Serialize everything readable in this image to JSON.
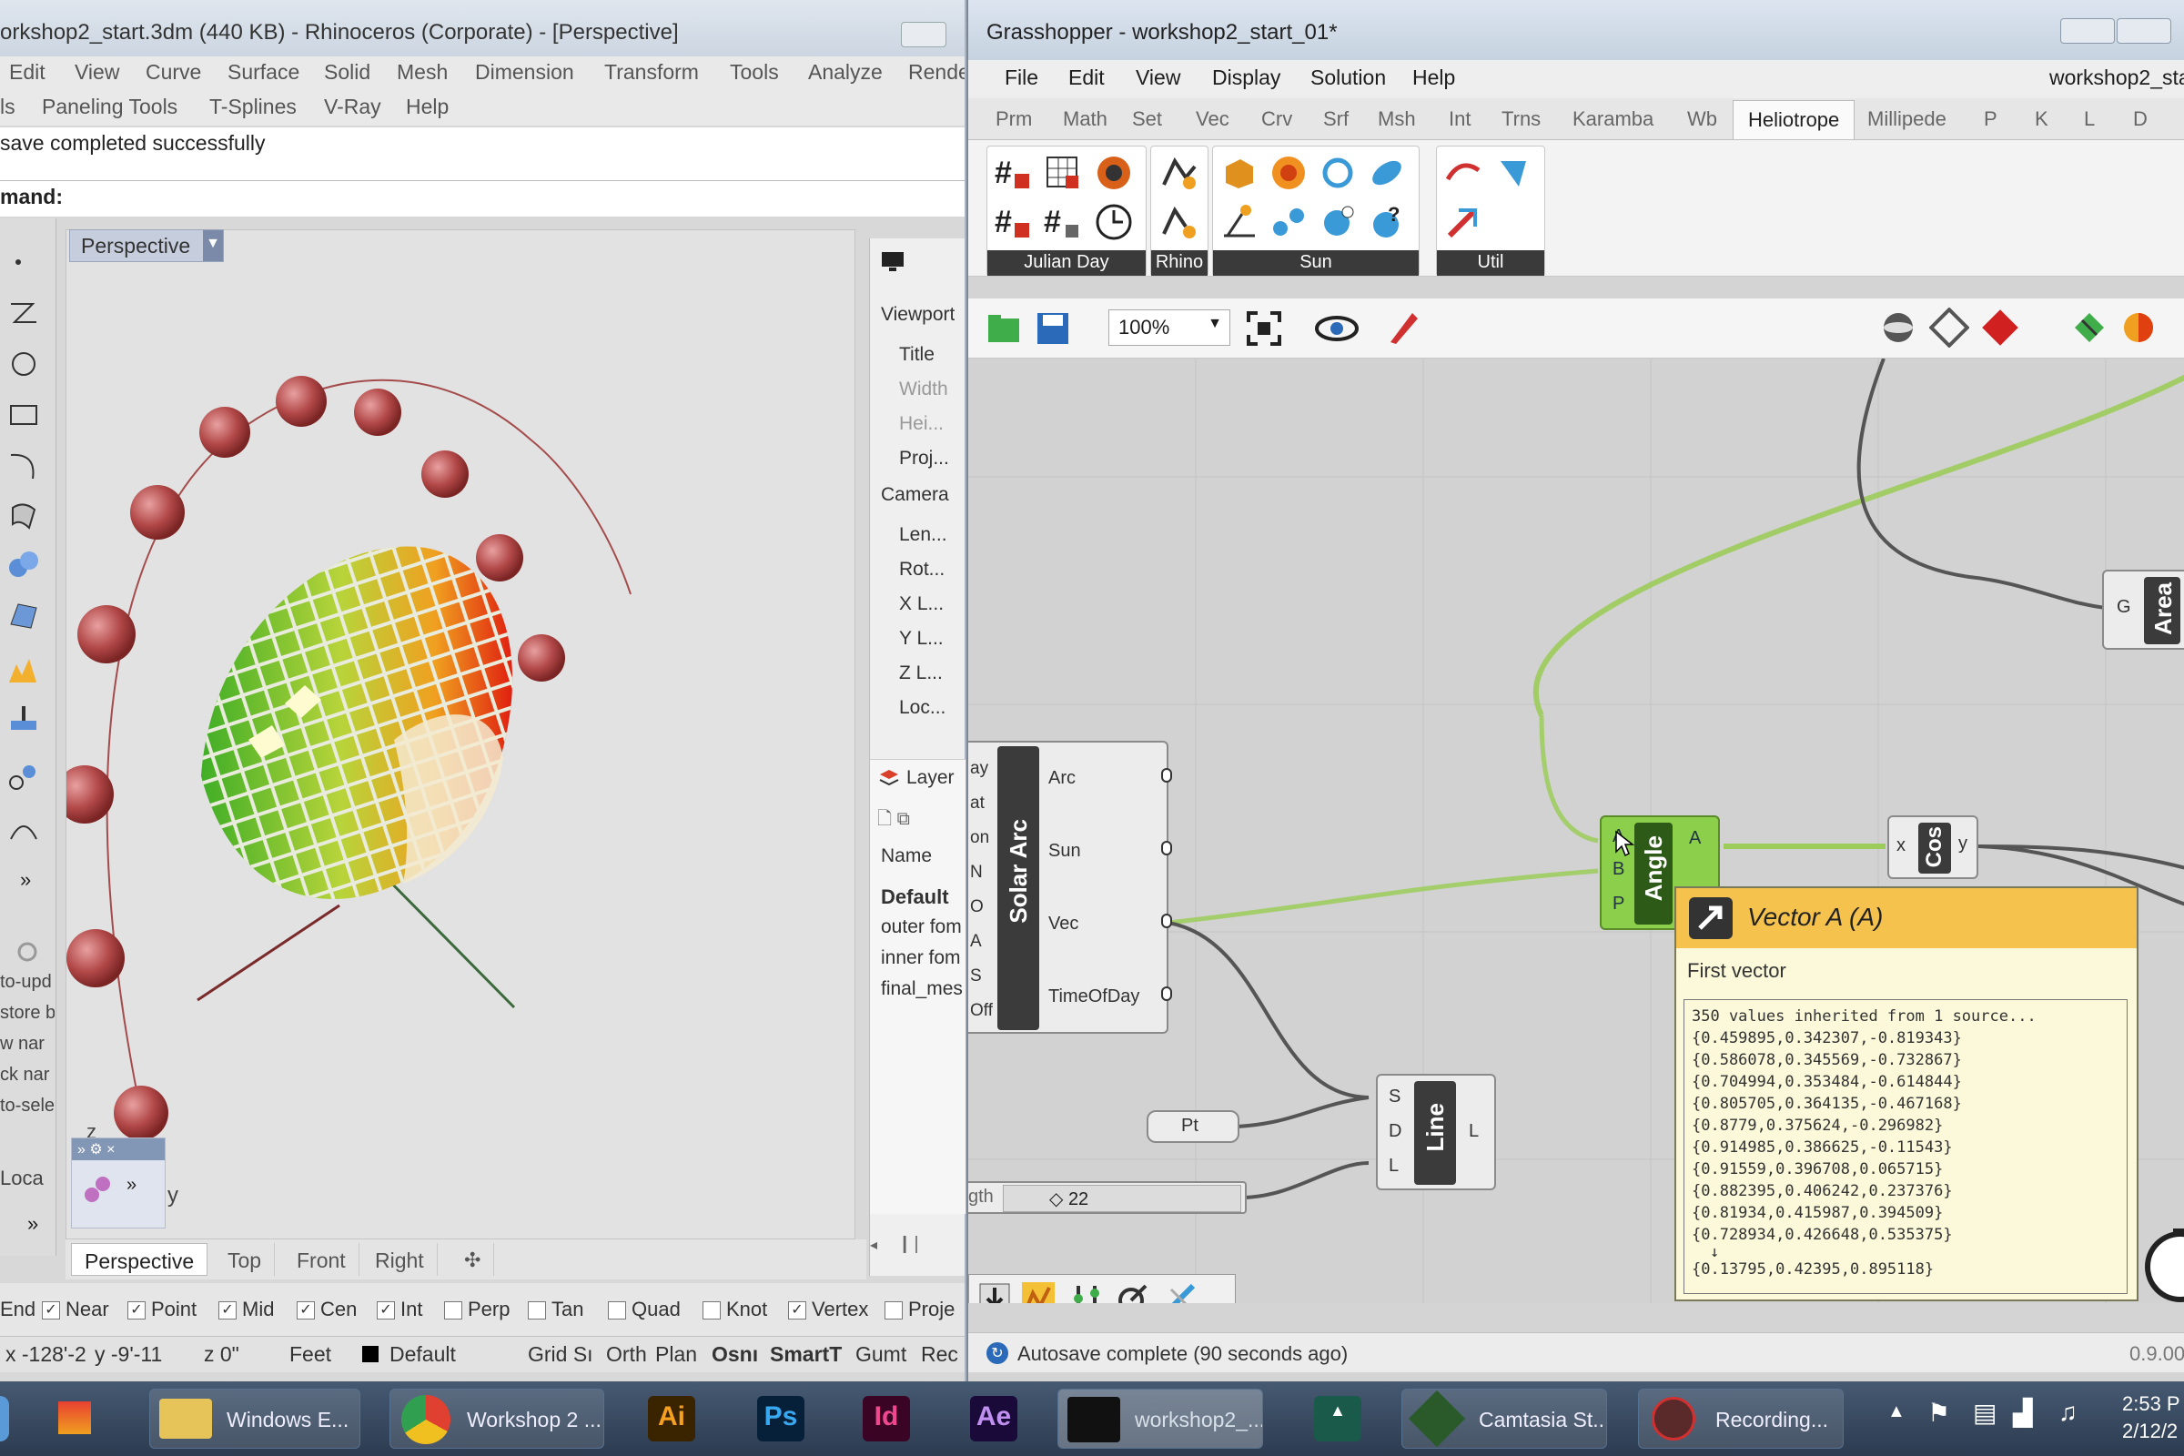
{
  "rhino": {
    "title": "orkshop2_start.3dm (440 KB) - Rhinoceros (Corporate) - [Perspective]",
    "menu_row1": [
      "Edit",
      "View",
      "Curve",
      "Surface",
      "Solid",
      "Mesh",
      "Dimension",
      "Transform",
      "Tools",
      "Analyze",
      "Rende"
    ],
    "menu_row2": [
      "ls",
      "Paneling Tools",
      "T-Splines",
      "V-Ray",
      "Help"
    ],
    "history_text": "save completed successfully",
    "command_label": "mand:",
    "viewport_label": "Perspective",
    "viewport_tabs": [
      "Perspective",
      "Top",
      "Front",
      "Right"
    ],
    "axis_z": "z",
    "axis_y": "y",
    "panel": {
      "viewport_header": "Viewport",
      "viewport_rows": [
        "Title",
        "Width",
        "Hei...",
        "Proj..."
      ],
      "camera_header": "Camera",
      "camera_rows": [
        "Len...",
        "Rot...",
        "X L...",
        "Y L...",
        "Z L...",
        "Loc..."
      ],
      "layers_title": "Layer",
      "layers_name_col": "Name",
      "layers": [
        "Default",
        "outer fom",
        "inner fom",
        "final_mes"
      ]
    },
    "left_fragments": [
      "to-upd",
      "store b",
      "w nar",
      "ck nar",
      "to-sele",
      "Loca"
    ],
    "osnap": [
      {
        "label": "End",
        "checked": true
      },
      {
        "label": "Near",
        "checked": true
      },
      {
        "label": "Point",
        "checked": true
      },
      {
        "label": "Mid",
        "checked": true
      },
      {
        "label": "Cen",
        "checked": true
      },
      {
        "label": "Int",
        "checked": true
      },
      {
        "label": "Perp",
        "checked": false
      },
      {
        "label": "Tan",
        "checked": false
      },
      {
        "label": "Quad",
        "checked": false
      },
      {
        "label": "Knot",
        "checked": false
      },
      {
        "label": "Vertex",
        "checked": true
      },
      {
        "label": "Proje",
        "checked": false
      }
    ],
    "status": {
      "x": "x -128'-2",
      "y": "y -9'-11",
      "z": "z 0\"",
      "units": "Feet",
      "layer": "Default",
      "toggles": [
        "Grid Sı",
        "Orth",
        "Plan",
        "Osnı",
        "SmartT",
        "Gumt",
        "Rec"
      ]
    }
  },
  "gh": {
    "title": "Grasshopper - workshop2_start_01*",
    "menu": [
      "File",
      "Edit",
      "View",
      "Display",
      "Solution",
      "Help"
    ],
    "doc_name": "workshop2_star",
    "tabs": [
      "Prm",
      "Math",
      "Set",
      "Vec",
      "Crv",
      "Srf",
      "Msh",
      "Int",
      "Trns",
      "Karamba",
      "Wb",
      "Heliotrope",
      "Millipede",
      "P",
      "K",
      "L",
      "D"
    ],
    "active_tab": "Heliotrope",
    "ribbon_groups": [
      "Julian Day",
      "Rhino",
      "Sun",
      "Util"
    ],
    "zoom": "100%",
    "components": {
      "solar_arc": {
        "name": "Solar Arc",
        "inputs": [
          "ay",
          "at",
          "on",
          "N",
          "O",
          "A",
          "S",
          "Off"
        ],
        "outputs": [
          "Arc",
          "Sun",
          "Vec",
          "TimeOfDay"
        ]
      },
      "angle": {
        "name": "Angle",
        "inputs": [
          "A",
          "B",
          "P"
        ],
        "outputs": [
          "A"
        ]
      },
      "cos": {
        "name": "Cos",
        "inputs": [
          "x"
        ],
        "outputs": [
          "y"
        ]
      },
      "area": {
        "name": "Area",
        "inputs": [
          "G"
        ]
      },
      "line": {
        "name": "Line",
        "inputs": [
          "S",
          "D",
          "L"
        ],
        "outputs": [
          "L"
        ]
      },
      "pt": {
        "name": "Pt"
      },
      "slider": {
        "label": "gth",
        "value": "◇ 22"
      }
    },
    "tooltip": {
      "title": "Vector A (A)",
      "subtitle": "First vector",
      "lines": [
        "350 values inherited from 1 source...",
        "{0.459895,0.342307,-0.819343}",
        "{0.586078,0.345569,-0.732867}",
        "{0.704994,0.353484,-0.614844}",
        "{0.805705,0.364135,-0.467168}",
        "{0.8779,0.375624,-0.296982}",
        "{0.914985,0.386625,-0.11543}",
        "{0.91559,0.396708,0.065715}",
        "{0.882395,0.406242,0.237376}",
        "{0.81934,0.415987,0.394509}",
        "{0.728934,0.426648,0.535375}",
        "↓",
        "{0.13795,0.42395,0.895118}"
      ]
    },
    "status_text": "Autosave complete (90 seconds ago)",
    "version": "0.9.00"
  },
  "taskbar": {
    "buttons": [
      "Windows E...",
      "Workshop 2 ...",
      "workshop2_...",
      "Camtasia St...",
      "Recording..."
    ],
    "apps": [
      "Ai",
      "Ps",
      "Id",
      "Ae"
    ],
    "time": "2:53 P",
    "date": "2/12/2"
  },
  "colors": {
    "tooltip_header": "#f4c24d",
    "wire_green": "#9ccc5a",
    "selected_component": "#8bcf4a"
  }
}
